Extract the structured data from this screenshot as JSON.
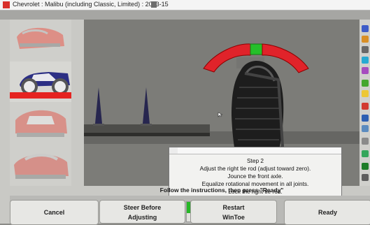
{
  "window": {
    "title": "Chevrolet : Malibu (including Classic, Limited) : 2013-15"
  },
  "instruction": "Follow the instructions, then press \"Ready\"",
  "dialog": {
    "step": "Step 2",
    "lines": [
      "Adjust the right tie rod (adjust toward zero).",
      "Jounce the front axle.",
      "Equalize rotational movement in all joints.",
      "Lock the right tie rod."
    ]
  },
  "buttons": {
    "cancel": "Cancel",
    "steer_line1": "Steer Before",
    "steer_line2": "Adjusting",
    "restart_line1": "Restart",
    "restart_line2": "WinToe",
    "ready": "Ready"
  },
  "colors": {
    "gauge_red": "#e0232a",
    "gauge_green": "#25c02a",
    "tire_dark": "#1d1d1d",
    "bench": "#4d4d4a"
  }
}
